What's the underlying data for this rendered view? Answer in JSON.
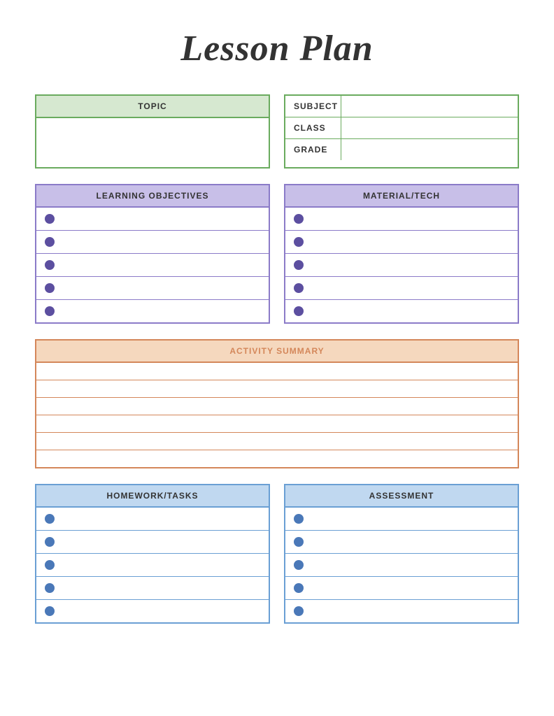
{
  "page": {
    "title": "Lesson Plan",
    "topic": {
      "header": "TOPIC",
      "value": ""
    },
    "subject_info": {
      "rows": [
        {
          "label": "SUBJECT",
          "value": ""
        },
        {
          "label": "CLASS",
          "value": ""
        },
        {
          "label": "GRADE",
          "value": ""
        }
      ]
    },
    "learning_objectives": {
      "header": "LEARNING OBJECTIVES",
      "rows": [
        "",
        "",
        "",
        "",
        ""
      ]
    },
    "material_tech": {
      "header": "MATERIAL/TECH",
      "rows": [
        "",
        "",
        "",
        "",
        ""
      ]
    },
    "activity_summary": {
      "header": "ACTIVITY SUMMARY",
      "rows": [
        "",
        "",
        "",
        "",
        "",
        ""
      ]
    },
    "homework_tasks": {
      "header": "HOMEWORK/TASKS",
      "rows": [
        "",
        "",
        "",
        "",
        ""
      ]
    },
    "assessment": {
      "header": "ASSESSMENT",
      "rows": [
        "",
        "",
        "",
        "",
        ""
      ]
    }
  }
}
